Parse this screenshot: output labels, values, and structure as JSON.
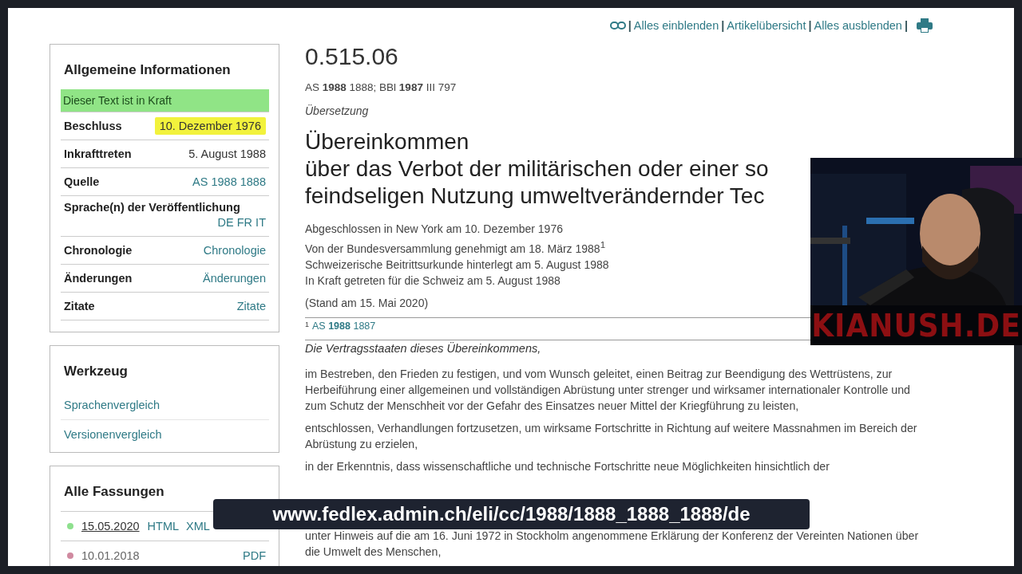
{
  "top_links": [
    {
      "kind": "separator",
      "text": "|"
    },
    {
      "kind": "link",
      "text": "Alles einblenden"
    },
    {
      "kind": "separator",
      "text": "|"
    },
    {
      "kind": "link",
      "text": "Artikelübersicht"
    },
    {
      "kind": "separator",
      "text": "|"
    },
    {
      "kind": "link",
      "text": "Alles ausblenden"
    },
    {
      "kind": "separator",
      "text": "|"
    }
  ],
  "info_panel": {
    "title": "Allgemeine Informationen",
    "status": "Dieser Text ist in Kraft",
    "rows": [
      {
        "label": "Beschluss",
        "value": "10. Dezember 1976",
        "kind": "text",
        "highlighted": true
      },
      {
        "label": "Inkrafttreten",
        "value": "5. August 1988",
        "kind": "text",
        "highlighted": false
      },
      {
        "label": "Quelle",
        "value": "AS 1988 1888",
        "kind": "link",
        "highlighted": false
      },
      {
        "label": "Sprache(n) der Veröffentlichung",
        "value": "DE FR IT",
        "kind": "link",
        "highlighted": false
      },
      {
        "label": "Chronologie",
        "value": "Chronologie",
        "kind": "link",
        "highlighted": false
      },
      {
        "label": "Änderungen",
        "value": "Änderungen",
        "kind": "link",
        "highlighted": false
      },
      {
        "label": "Zitate",
        "value": "Zitate",
        "kind": "link",
        "highlighted": false
      }
    ]
  },
  "tools_panel": {
    "title": "Werkzeug",
    "links": [
      "Sprachenvergleich",
      "Versionenvergleich"
    ]
  },
  "versions_panel": {
    "title": "Alle Fassungen",
    "versions": [
      {
        "date": "15.05.2020",
        "selected": true,
        "color": "#8ee08e",
        "formats": [
          "HTML",
          "XML"
        ]
      },
      {
        "date": "10.01.2018",
        "selected": false,
        "color": "#d08aa0",
        "formats": [
          "PDF"
        ]
      }
    ]
  },
  "document": {
    "number": "0.515.06",
    "reference": "AS **1988** 1888; BBl **1987** III 797",
    "note": "Übersetzung",
    "title_lines": [
      "Übereinkommen",
      "über das Verbot der militärischen oder einer so",
      "feindseligen Nutzung umweltverändernder Tec"
    ],
    "facts": [
      "Abgeschlossen in New York am 10. Dezember 1976",
      "Von der Bundesversammlung genehmigt am 18. März 1988$^{1}$",
      "Schweizerische Beitrittsurkunde hinterlegt am 5. August 1988",
      "In Kraft getreten für die Schweiz am 5. August 1988"
    ],
    "status": "(Stand am 15. Mai 2020)",
    "footnote_mark": "1",
    "footnote": "AS **1988** 1887",
    "preamble": "Die Vertragsstaaten dieses Übereinkommens,",
    "paragraphs": [
      "im Bestreben, den Frieden zu festigen, und vom Wunsch geleitet, einen Beitrag zur Beendigung des Wettrüstens, zur Herbeiführung einer allgemeinen und vollständigen Abrüstung unter strenger und wirksamer internationaler Kontrolle und zum Schutz der Menschheit vor der Gefahr des Einsatzes neuer Mittel der Kriegführung zu leisten,",
      "entschlossen, Verhandlungen fortzusetzen, um wirksame Fortschritte in Richtung auf weitere Massnahmen im Bereich der Abrüstung zu erzielen,",
      "in der Erkenntnis, dass wissenschaftliche und technische Fortschritte neue Möglichkeiten hinsichtlich der",
      "unter Hinweis auf die am 16. Juni 1972 in Stockholm angenommene Erklärung der Konferenz der Vereinten Nationen über die Umwelt des Menschen,"
    ]
  },
  "url_caption": "www.fedlex.admin.ch/eli/cc/1988/1888_1888_1888/de",
  "webcam": {
    "kind": "picture",
    "caption": "KIANUSH.DE"
  }
}
